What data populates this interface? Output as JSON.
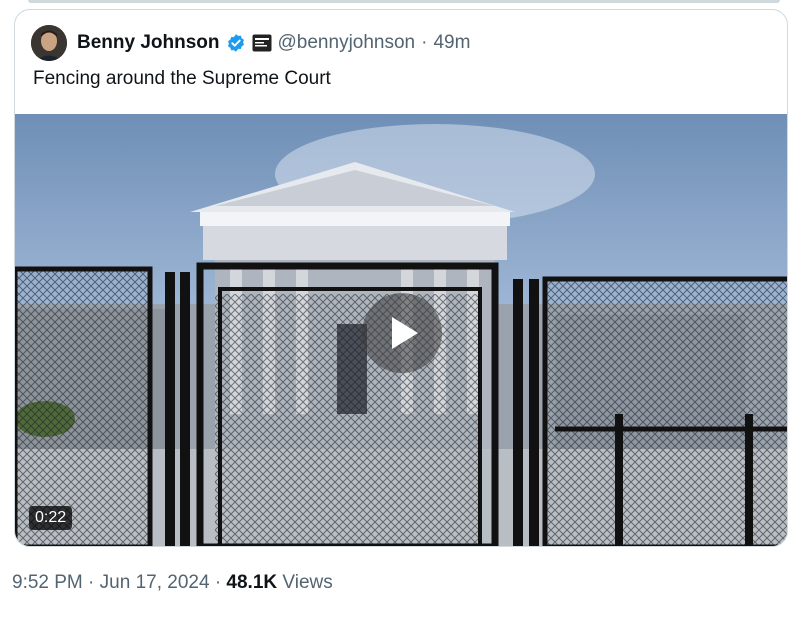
{
  "quoted_tweet": {
    "author": {
      "display_name": "Benny Johnson",
      "handle": "@bennyjohnson",
      "verified": true,
      "affiliation_badge_icon": "affiliation-badge-icon"
    },
    "separator": "·",
    "time_ago": "49m",
    "text": "Fencing around the Supreme Court",
    "media": {
      "type": "video",
      "duration": "0:22",
      "play_icon": "play-icon"
    }
  },
  "footer": {
    "time": "9:52 PM",
    "separator1": "·",
    "date": "Jun 17, 2024",
    "separator2": "·",
    "views_count": "48.1K",
    "views_label": "Views"
  },
  "colors": {
    "text_primary": "#0f1419",
    "text_secondary": "#536471",
    "verified_blue": "#1d9bf0",
    "border": "#cfd9de"
  }
}
